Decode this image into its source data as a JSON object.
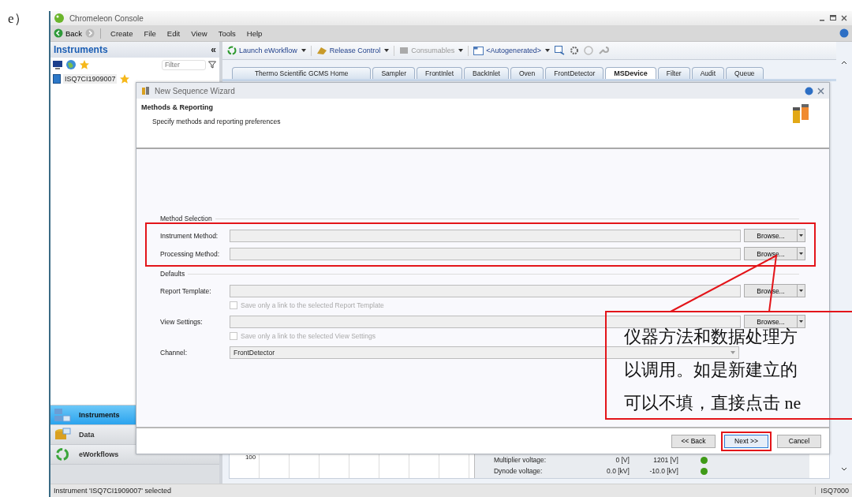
{
  "page_label": "e）",
  "window": {
    "title": "Chromeleon Console"
  },
  "nav": {
    "back": "Back"
  },
  "menu": [
    "Create",
    "File",
    "Edit",
    "View",
    "Tools",
    "Help"
  ],
  "sidebar": {
    "title": "Instruments",
    "collapse": "«",
    "filter_placeholder": "Filter",
    "items": [
      {
        "label": "ISQ7CI1909007",
        "favorite": true
      }
    ],
    "nav": [
      {
        "label": "Instruments",
        "selected": true,
        "kind": "instruments"
      },
      {
        "label": "Data",
        "selected": false,
        "kind": "data"
      },
      {
        "label": "eWorkflows",
        "selected": false,
        "kind": "workflows"
      }
    ]
  },
  "toolbar": [
    {
      "label": "Launch eWorkflow",
      "kind": "workflow",
      "disabled": false
    },
    {
      "label": "Release Control",
      "kind": "release",
      "disabled": false
    },
    {
      "label": "Consumables",
      "kind": "consumables",
      "disabled": true
    },
    {
      "label": "<Autogenerated>",
      "kind": "layout",
      "disabled": false
    }
  ],
  "tabs": [
    {
      "label": "Thermo Scientific GCMS Home",
      "selected": false
    },
    {
      "label": "Sampler",
      "selected": false
    },
    {
      "label": "FrontInlet",
      "selected": false
    },
    {
      "label": "BackInlet",
      "selected": false
    },
    {
      "label": "Oven",
      "selected": false
    },
    {
      "label": "FrontDetector",
      "selected": false
    },
    {
      "label": "MSDevice",
      "selected": true
    },
    {
      "label": "Filter",
      "selected": false
    },
    {
      "label": "Audit",
      "selected": false
    },
    {
      "label": "Queue",
      "selected": false
    }
  ],
  "background_panel": {
    "axis_tick": "100",
    "readings": [
      {
        "name": "Multiplier voltage:",
        "actual": "0 [V]",
        "setpoint": "1201 [V]",
        "color": "#3f9a17"
      },
      {
        "name": "Dynode voltage:",
        "actual": "0.0 [kV]",
        "setpoint": "-10.0 [kV]",
        "color": "#3f9a17"
      }
    ]
  },
  "dialog": {
    "title": "New Sequence Wizard",
    "heading": "Methods & Reporting",
    "subheading": "Specify methods and reporting preferences",
    "sections": [
      {
        "title": "Method Selection",
        "annotated": true,
        "rows": [
          {
            "label": "Instrument Method:",
            "kind": "browse",
            "button": "Browse..."
          },
          {
            "label": "Processing Method:",
            "kind": "browse",
            "button": "Browse..."
          }
        ]
      },
      {
        "title": "Defaults",
        "annotated": false,
        "rows": [
          {
            "label": "Report Template:",
            "kind": "browse",
            "button": "Browse...",
            "option": {
              "label": "Save only a link to the selected Report Template",
              "checked": false,
              "disabled": true
            }
          },
          {
            "label": "View Settings:",
            "kind": "browse",
            "button": "Browse...",
            "option": {
              "label": "Save only a link to the selected View Settings",
              "checked": false,
              "disabled": true
            }
          },
          {
            "label": "Channel:",
            "kind": "select",
            "value": "FrontDetector"
          }
        ]
      }
    ],
    "buttons": [
      {
        "label": "<< Back",
        "default": false,
        "annotated": false
      },
      {
        "label": "Next >>",
        "default": true,
        "annotated": true
      },
      {
        "label": "Cancel",
        "default": false,
        "annotated": false
      }
    ]
  },
  "status_bar": {
    "message": "Instrument 'ISQ7CI1909007' selected",
    "instrument": "ISQ7000"
  },
  "annotation": {
    "lines": [
      "仪器方法和数据处理方",
      "以调用。如是新建立的",
      "可以不填，直接点击 ne"
    ]
  }
}
